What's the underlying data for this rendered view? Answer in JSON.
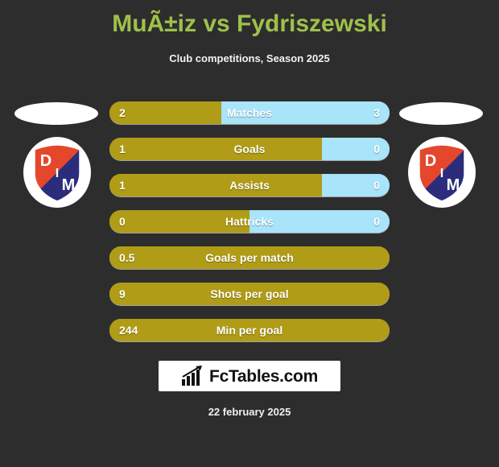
{
  "header": {
    "title": "MuÃ±iz vs Fydriszewski",
    "subtitle": "Club competitions, Season 2025"
  },
  "colors": {
    "background": "#2e2d2d",
    "title": "#9ec14a",
    "home_bar": "#b09c16",
    "away_bar": "#a8e4fa",
    "crest_red": "#e5472c",
    "crest_navy": "#2b2d7c",
    "crest_white": "#ffffff"
  },
  "crest": {
    "name": "Independiente Medellin",
    "letters": [
      "D",
      "I",
      "M"
    ]
  },
  "stats": {
    "rows": [
      {
        "label": "Matches",
        "home": "2",
        "away": "3",
        "home_pct": 40,
        "away_pct": 60,
        "split": true
      },
      {
        "label": "Goals",
        "home": "1",
        "away": "0",
        "home_pct": 76,
        "away_pct": 24,
        "split": true
      },
      {
        "label": "Assists",
        "home": "1",
        "away": "0",
        "home_pct": 76,
        "away_pct": 24,
        "split": true
      },
      {
        "label": "Hattricks",
        "home": "0",
        "away": "0",
        "home_pct": 50,
        "away_pct": 50,
        "split": true
      },
      {
        "label": "Goals per match",
        "home": "0.5",
        "away": "",
        "home_pct": 100,
        "away_pct": 0,
        "split": false
      },
      {
        "label": "Shots per goal",
        "home": "9",
        "away": "",
        "home_pct": 100,
        "away_pct": 0,
        "split": false
      },
      {
        "label": "Min per goal",
        "home": "244",
        "away": "",
        "home_pct": 100,
        "away_pct": 0,
        "split": false
      }
    ]
  },
  "footer": {
    "logo_text": "FcTables.com",
    "logo_icon": "bar-chart-arrow-icon",
    "date": "22 february 2025"
  }
}
